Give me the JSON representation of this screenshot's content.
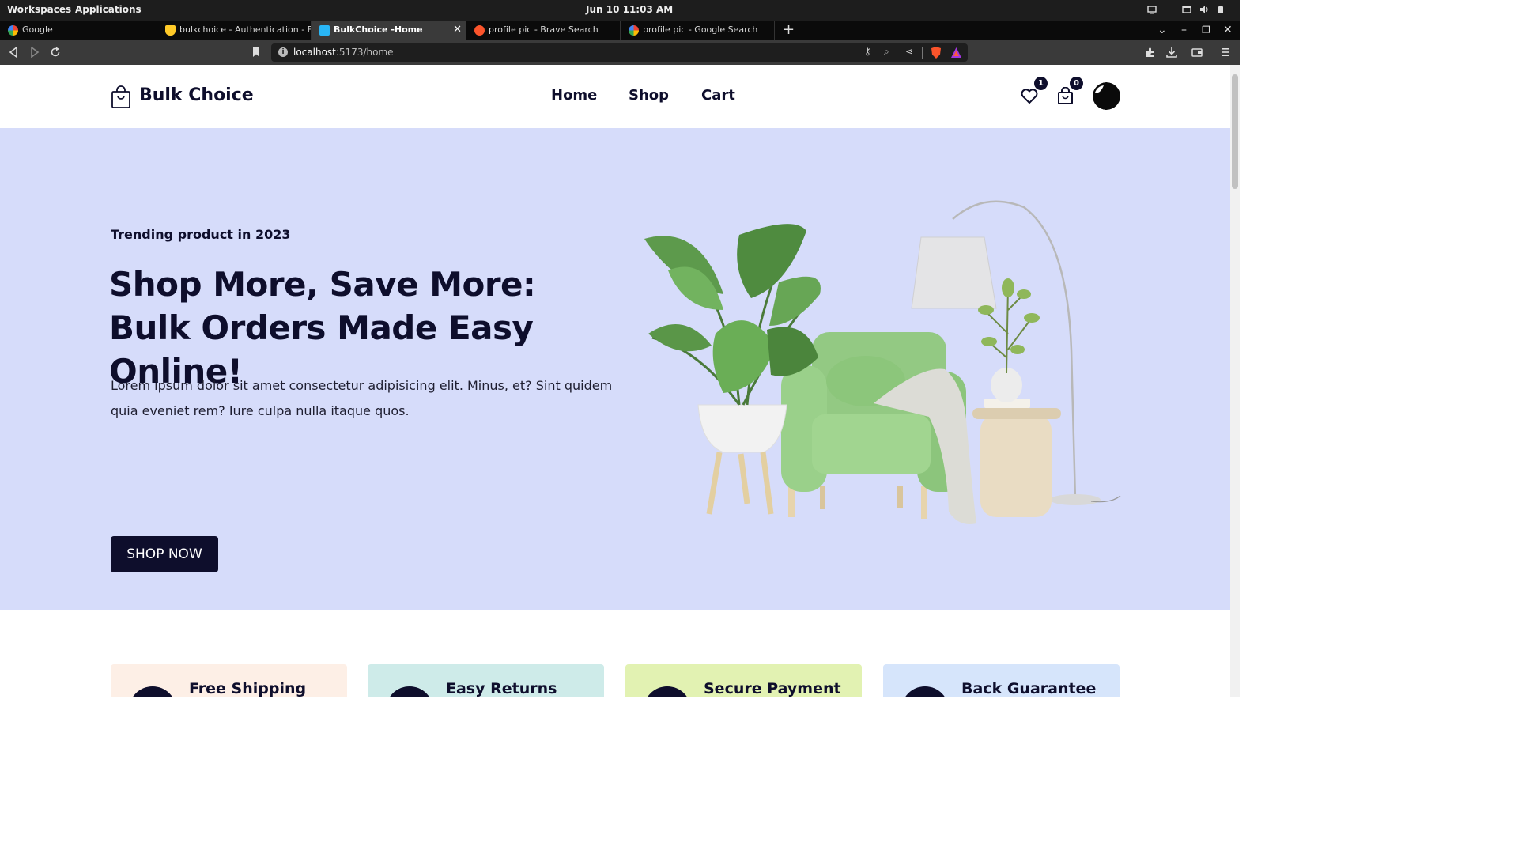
{
  "os_bar": {
    "workspaces": "Workspaces",
    "applications": "Applications",
    "clock": "Jun 10  11:03 AM"
  },
  "tabs": [
    {
      "label": "Google",
      "favicon": "google-icon",
      "active": false
    },
    {
      "label": "bulkchoice - Authentication - Fire",
      "favicon": "firebase-icon",
      "active": false
    },
    {
      "label": "BulkChoice -Home",
      "favicon": "site-icon",
      "active": true
    },
    {
      "label": "profile pic - Brave Search",
      "favicon": "brave-icon",
      "active": false
    },
    {
      "label": "profile pic - Google Search",
      "favicon": "google-icon",
      "active": false
    }
  ],
  "address_bar": {
    "host": "localhost",
    "path": ":5173/home"
  },
  "site": {
    "logo_text": "Bulk Choice",
    "nav": [
      "Home",
      "Shop",
      "Cart"
    ],
    "wishlist_count": "1",
    "cart_count": "0"
  },
  "hero": {
    "subtitle": "Trending product in 2023",
    "title": "Shop More, Save More: Bulk Orders Made Easy Online!",
    "description": "Lorem ipsum dolor sit amet consectetur adipisicing elit. Minus, et? Sint quidem quia eveniet rem? Iure culpa nulla itaque quos.",
    "button": "SHOP NOW"
  },
  "services": [
    {
      "title": "Free Shipping",
      "bg": "#fdefe6"
    },
    {
      "title": "Easy Returns",
      "bg": "#ceebe9"
    },
    {
      "title": "Secure Payment",
      "bg": "#e2f2b2"
    },
    {
      "title": "Back Guarantee",
      "bg": "#d6e5fb"
    }
  ],
  "colors": {
    "primary": "#0e0e2c",
    "hero_bg": "#d6dcfa"
  }
}
